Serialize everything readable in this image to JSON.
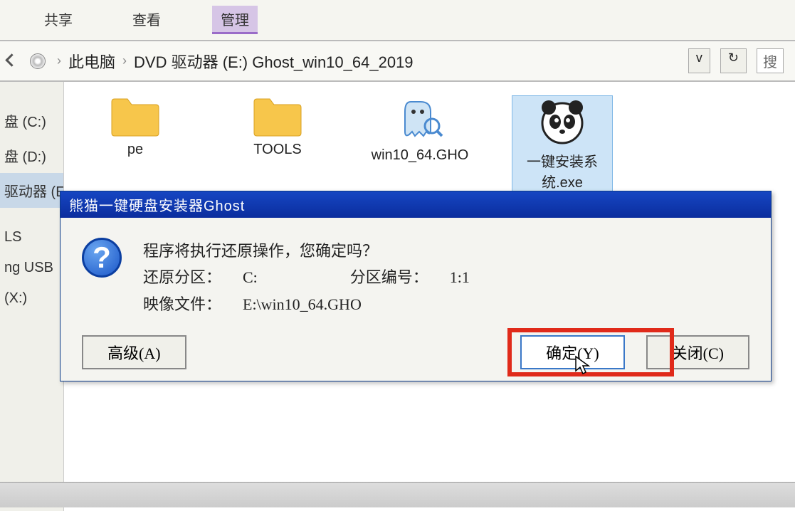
{
  "ribbon": {
    "share": "共享",
    "view": "查看",
    "manage": "管理"
  },
  "breadcrumb": {
    "this_pc": "此电脑",
    "drive_label": "DVD 驱动器 (E:) Ghost_win10_64_2019",
    "dropdown": "v",
    "refresh": "↻",
    "search_hint": "搜"
  },
  "sidebar": {
    "items": [
      "盘 (C:)",
      "盘 (D:)",
      "驱动器 (E:) G",
      "",
      "LS",
      "ng USB",
      "(X:)"
    ]
  },
  "files": [
    {
      "name": "pe",
      "type": "folder"
    },
    {
      "name": "TOOLS",
      "type": "folder"
    },
    {
      "name": "win10_64.GHO",
      "type": "gho"
    },
    {
      "name": "一键安装系统.exe",
      "type": "panda"
    }
  ],
  "dialog": {
    "title": "熊猫一键硬盘安装器Ghost",
    "message": "程序将执行还原操作，您确定吗？",
    "partition_label": "还原分区：",
    "partition_value": "C:",
    "partition_no_label": "分区编号：",
    "partition_no_value": "1:1",
    "image_label": "映像文件：",
    "image_value": "E:\\win10_64.GHO",
    "btn_advanced": "高级(A)",
    "btn_ok": "确定(Y)",
    "btn_close": "关闭(C)"
  }
}
